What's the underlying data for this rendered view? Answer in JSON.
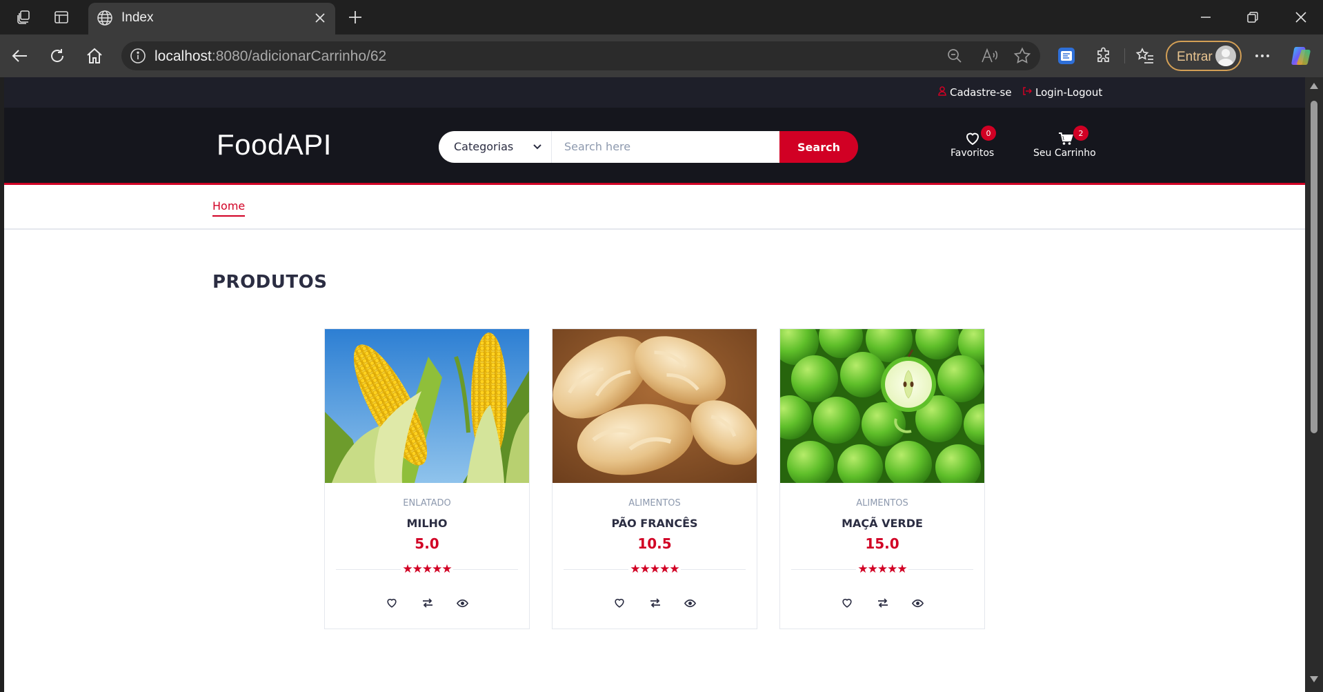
{
  "browser": {
    "tab_title": "Index",
    "url_host": "localhost",
    "url_path": ":8080/adicionarCarrinho/62",
    "profile_label": "Entrar"
  },
  "site": {
    "top_links": {
      "register": "Cadastre-se",
      "login": "Login-Logout"
    },
    "logo": "FoodAPI",
    "search": {
      "category_label": "Categorias",
      "placeholder": "Search here",
      "button_label": "Search"
    },
    "favorites": {
      "label": "Favoritos",
      "count": "0"
    },
    "cart": {
      "label": "Seu Carrinho",
      "count": "2"
    },
    "nav": {
      "home": "Home"
    },
    "section_title": "PRODUTOS",
    "colors": {
      "accent": "#d10024",
      "header_dark": "#15161d",
      "top_header": "#1e1f29"
    }
  },
  "products": [
    {
      "category": "ENLATADO",
      "name": "MILHO",
      "price": "5.0",
      "rating": 5,
      "image": "corn"
    },
    {
      "category": "ALIMENTOS",
      "name": "PÃO FRANCÊS",
      "price": "10.5",
      "rating": 5,
      "image": "bread"
    },
    {
      "category": "ALIMENTOS",
      "name": "MAÇÃ VERDE",
      "price": "15.0",
      "rating": 5,
      "image": "green-apples"
    }
  ]
}
